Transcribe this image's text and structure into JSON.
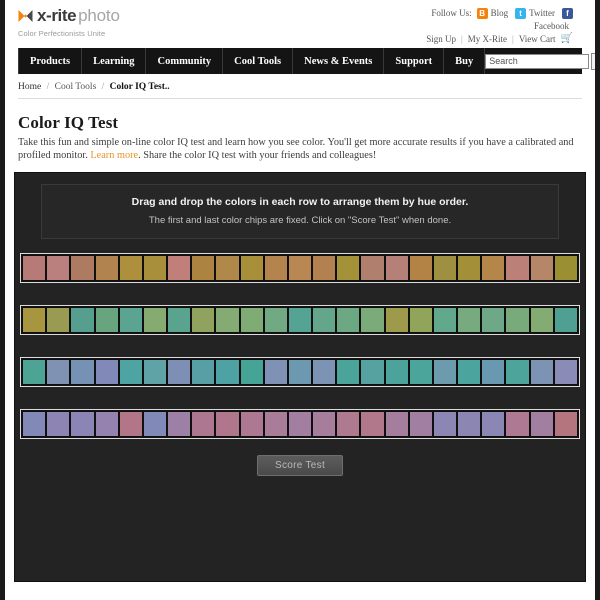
{
  "brand": {
    "name_bold": "x-rite",
    "name_light": "photo",
    "tagline": "Color Perfectionists Unite",
    "logo_icon": "xrite-bowtie-icon",
    "accent_color": "#f5820b"
  },
  "social": {
    "follow_label": "Follow Us:",
    "links": [
      {
        "label": "Blog",
        "badge": "B",
        "color": "#f5820b",
        "icon": "rss-icon"
      },
      {
        "label": "Twitter",
        "badge": "t",
        "color": "#36b4ee",
        "icon": "twitter-icon"
      },
      {
        "label": "Facebook",
        "badge": "f",
        "color": "#3b5998",
        "icon": "facebook-icon"
      }
    ]
  },
  "utility": {
    "items": [
      "Sign Up",
      "My X-Rite",
      "View Cart"
    ],
    "separator": "|",
    "cart_icon": "shopping-cart-icon"
  },
  "nav": {
    "items": [
      "Products",
      "Learning",
      "Community",
      "Cool Tools",
      "News & Events",
      "Support",
      "Buy"
    ]
  },
  "search": {
    "value": "Search",
    "placeholder": "Search",
    "button_icon": "magnifier-icon"
  },
  "breadcrumb": {
    "items": [
      "Home",
      "Cool Tools",
      "Color IQ Test.."
    ],
    "separator": "/"
  },
  "intro": {
    "title": "Color IQ Test",
    "desc_part1": "Take this fun and simple on-line color IQ test and learn how you see color. You'll get more accurate results if you have a calibrated and profiled monitor. ",
    "link_text": "Learn more",
    "desc_part2": ". Share the color IQ test with your friends and colleagues!"
  },
  "test": {
    "instruction_main": "Drag and drop the colors in each row to arrange them by hue order.",
    "instruction_sub": "The first and last color chips are fixed. Click on \"Score Test\" when done.",
    "score_button": "Score Test",
    "rows": [
      {
        "name": "row-1",
        "chips": [
          "#b77b77",
          "#b9807d",
          "#ad7a62",
          "#b1834f",
          "#ad8f3e",
          "#a88f3c",
          "#c08079",
          "#ad8341",
          "#b08849",
          "#a79039",
          "#b4844e",
          "#b98751",
          "#b3814f",
          "#a49238",
          "#b07f6e",
          "#b58077",
          "#b38245",
          "#9e9040",
          "#a38f38",
          "#b4864a",
          "#bb8077",
          "#b58668",
          "#9a9033"
        ]
      },
      {
        "name": "row-2",
        "chips": [
          "#a8953f",
          "#9a9b52",
          "#569e8e",
          "#68a57f",
          "#5ba492",
          "#86ab71",
          "#5aa48f",
          "#8fa35f",
          "#84ab73",
          "#7fab75",
          "#71a982",
          "#55a392",
          "#63a68c",
          "#6da885",
          "#7aab79",
          "#9d9a4b",
          "#90a45a",
          "#62a88d",
          "#77aa7e",
          "#6ea886",
          "#79aa7b",
          "#84ab72",
          "#4fa092"
        ]
      },
      {
        "name": "row-3",
        "chips": [
          "#4da394",
          "#7f92b4",
          "#7592b4",
          "#8089b7",
          "#4da4a2",
          "#5fa3a6",
          "#7d8fb5",
          "#589fa5",
          "#4fa2a4",
          "#46a497",
          "#7f92b5",
          "#6d99b0",
          "#7d93b3",
          "#4ba49a",
          "#56a2a1",
          "#4ca39c",
          "#4ba59b",
          "#6c9bae",
          "#4ba49e",
          "#6899b0",
          "#4ca49a",
          "#7d93b4",
          "#8a8bb7"
        ]
      },
      {
        "name": "row-4",
        "chips": [
          "#8289b7",
          "#8d84b3",
          "#8a85b5",
          "#9682ae",
          "#b27688",
          "#8189b8",
          "#9c80a6",
          "#ad7791",
          "#b0768c",
          "#ad7891",
          "#a97c99",
          "#a27ea1",
          "#a67d9b",
          "#ad7a8f",
          "#b0788a",
          "#a57e9d",
          "#a07fa3",
          "#8b86b4",
          "#8c86b3",
          "#8a87b5",
          "#ae7a93",
          "#a27fa1",
          "#b4757f"
        ]
      }
    ]
  }
}
